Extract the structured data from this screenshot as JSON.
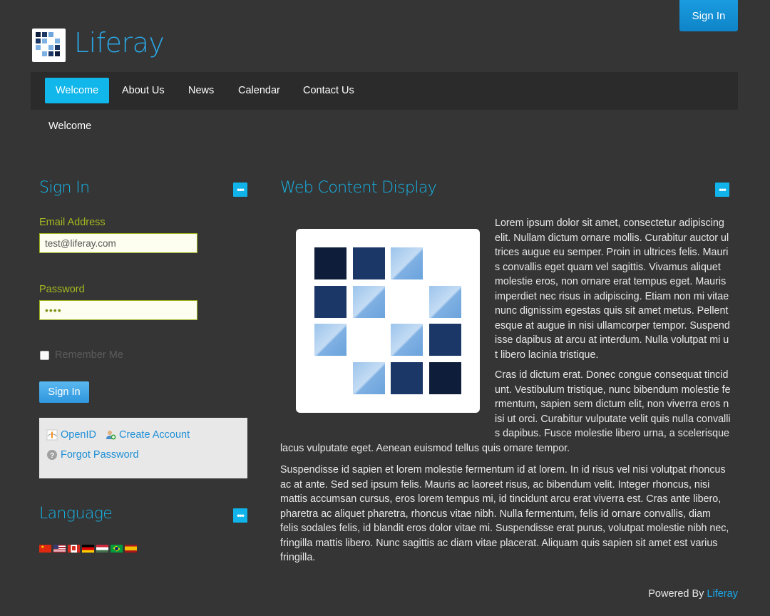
{
  "header": {
    "sign_in_label": "Sign In",
    "site_name": "Liferay"
  },
  "nav": {
    "items": [
      {
        "label": "Welcome",
        "active": true
      },
      {
        "label": "About Us",
        "active": false
      },
      {
        "label": "News",
        "active": false
      },
      {
        "label": "Calendar",
        "active": false
      },
      {
        "label": "Contact Us",
        "active": false
      }
    ]
  },
  "breadcrumb": {
    "current": "Welcome"
  },
  "sign_in_portlet": {
    "title": "Sign In",
    "options_icon": "options-icon",
    "email_label": "Email Address",
    "email_value": "test@liferay.com",
    "password_label": "Password",
    "password_value": "••••",
    "remember_label": "Remember Me",
    "submit_label": "Sign In",
    "links": {
      "openid": "OpenID",
      "create_account": "Create Account",
      "forgot_password": "Forgot Password"
    }
  },
  "language_portlet": {
    "title": "Language",
    "flags": [
      "flag-cn",
      "flag-us",
      "flag-ca",
      "flag-de",
      "flag-hu",
      "flag-br",
      "flag-es"
    ]
  },
  "web_content_portlet": {
    "title": "Web Content Display",
    "paragraph_1": "Lorem ipsum dolor sit amet, consectetur adipiscing elit. Nullam dictum ornare mollis. Curabitur auctor ultrices augue eu semper. Proin in ultrices felis. Mauris convallis eget quam vel sagittis. Vivamus aliquet molestie eros, non ornare erat tempus eget. Mauris imperdiet nec risus in adipiscing. Etiam non mi vitae nunc dignissim egestas quis sit amet metus. Pellentesque at augue in nisi ullamcorper tempor. Suspendisse dapibus at arcu at interdum. Nulla volutpat mi ut libero lacinia tristique.",
    "paragraph_2": "Cras id dictum erat. Donec congue consequat tincidunt. Vestibulum tristique, nunc bibendum molestie fermentum, sapien sem dictum elit, non viverra eros nisi ut orci. Curabitur vulputate velit quis nulla convallis dapibus. Fusce molestie libero urna, a scelerisque lacus vulputate eget. Aenean euismod tellus quis ornare tempor.",
    "paragraph_3": "Suspendisse id sapien et lorem molestie fermentum id at lorem. In id risus vel nisi volutpat rhoncus ac at ante. Sed sed ipsum felis. Mauris ac laoreet risus, ac bibendum velit. Integer rhoncus, nisi mattis accumsan cursus, eros lorem tempus mi, id tincidunt arcu erat viverra est. Cras ante libero, pharetra ac aliquet pharetra, rhoncus vitae nibh. Nulla fermentum, felis id ornare convallis, diam felis sodales felis, id blandit eros dolor vitae mi. Suspendisse erat purus, volutpat molestie nibh nec, fringilla mattis libero. Nunc sagittis ac diam vitae placerat. Aliquam quis sapien sit amet est varius fringilla."
  },
  "footer": {
    "powered_by": "Powered By",
    "brand": "Liferay"
  },
  "colors": {
    "accent": "#16b5e8",
    "background": "#353535",
    "label_green": "#a5b820"
  }
}
